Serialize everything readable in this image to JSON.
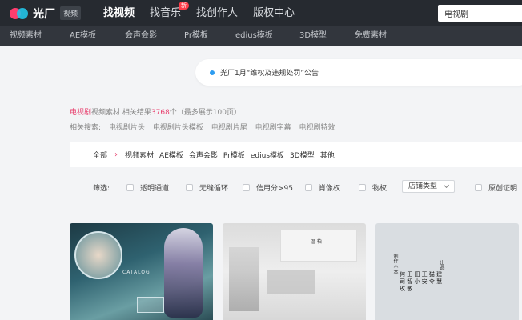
{
  "brand": {
    "name": "光厂",
    "tag": "视频"
  },
  "nav": [
    {
      "label": "找视频",
      "active": true
    },
    {
      "label": "找音乐",
      "badge": "新"
    },
    {
      "label": "找创作人"
    },
    {
      "label": "版权中心"
    }
  ],
  "search": {
    "value": "电视剧"
  },
  "subnav": [
    "视频素材",
    "AE模板",
    "会声会影",
    "Pr模板",
    "edius模板",
    "3D模型",
    "免费素材"
  ],
  "notice": {
    "text": "光厂1月“维权及违规处罚”公告"
  },
  "result": {
    "keyword": "电视剧",
    "label": "视频素材 相关结果",
    "count": "3768",
    "suffix": "个（最多展示100页）"
  },
  "related": {
    "label": "相关搜索:",
    "items": [
      "电视剧片头",
      "电视剧片头模板",
      "电视剧片尾",
      "电视剧字幕",
      "电视剧特效"
    ]
  },
  "categories": {
    "all": "全部",
    "items": [
      "视频素材",
      "AE模板",
      "会声会影",
      "Pr模板",
      "edius模板",
      "3D模型",
      "其他"
    ]
  },
  "filters": {
    "label": "筛选:",
    "options": [
      "透明通道",
      "无缝循环",
      "信用分>95",
      "肖像权",
      "物权"
    ],
    "dropdown": "店铺类型",
    "last": "原创证明"
  },
  "cards": {
    "card1_text": "CATALOG",
    "card2_text": "温 柏",
    "card3_vertical": "制作人 本",
    "card3_title": "何 王 田 王 猫 建 司 智 小 安 令 慧 玫 敏",
    "card3_vertical2": "出品"
  },
  "colors": {
    "accent": "#e8406e",
    "topbar": "#262a30",
    "subbar": "#32363d"
  }
}
